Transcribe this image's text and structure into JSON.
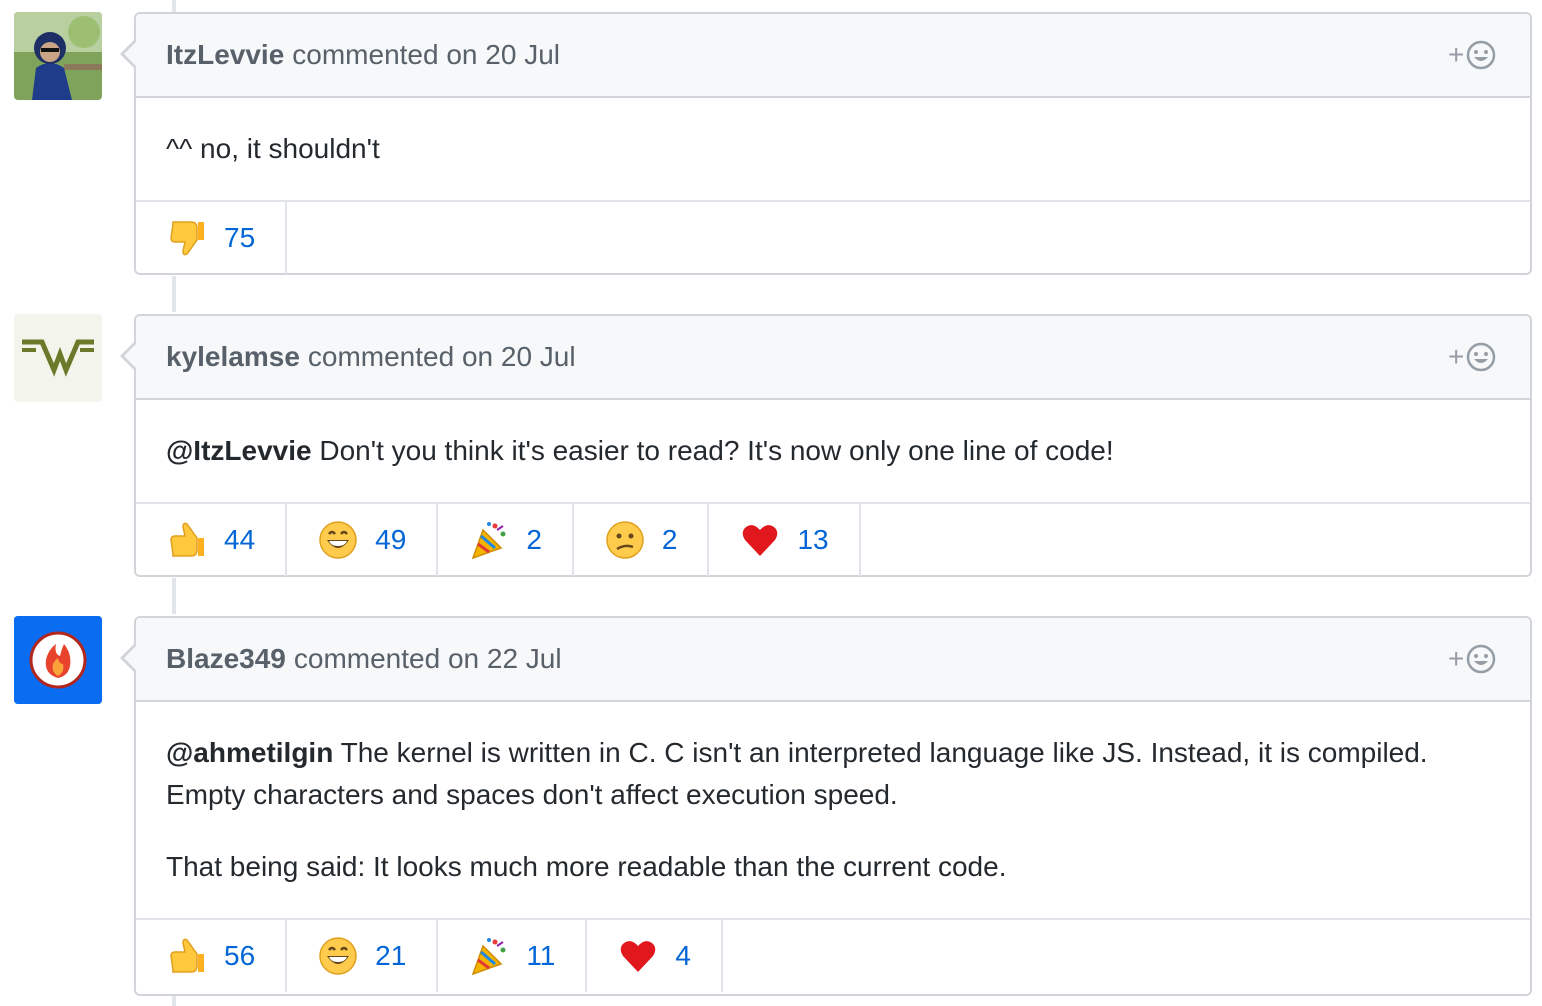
{
  "comments": [
    {
      "author": "ItzLevvie",
      "meta": "commented on 20 Jul",
      "paragraphs": [
        {
          "mention": "",
          "text": "^^ no, it shouldn't"
        }
      ],
      "reactions": [
        {
          "icon": "thumbs-down-icon",
          "count": "75"
        }
      ]
    },
    {
      "author": "kylelamse",
      "meta": "commented on 20 Jul",
      "paragraphs": [
        {
          "mention": "@ItzLevvie",
          "text": " Don't you think it's easier to read? It's now only one line of code!"
        }
      ],
      "reactions": [
        {
          "icon": "thumbs-up-icon",
          "count": "44"
        },
        {
          "icon": "laugh-icon",
          "count": "49"
        },
        {
          "icon": "hooray-icon",
          "count": "2"
        },
        {
          "icon": "confused-icon",
          "count": "2"
        },
        {
          "icon": "heart-icon",
          "count": "13"
        }
      ]
    },
    {
      "author": "Blaze349",
      "meta": "commented on 22 Jul",
      "paragraphs": [
        {
          "mention": "@ahmetilgin",
          "text": " The kernel is written in C. C isn't an interpreted language like JS. Instead, it is compiled. Empty characters and spaces don't affect execution speed."
        },
        {
          "mention": "",
          "text": "That being said: It looks much more readable than the current code."
        }
      ],
      "reactions": [
        {
          "icon": "thumbs-up-icon",
          "count": "56"
        },
        {
          "icon": "laugh-icon",
          "count": "21"
        },
        {
          "icon": "hooray-icon",
          "count": "11"
        },
        {
          "icon": "heart-icon",
          "count": "4"
        }
      ]
    }
  ],
  "add_reaction_label": "+",
  "colors": {
    "link": "#0366d6",
    "header_bg": "#f6f8fa",
    "border": "#d1d5da"
  }
}
